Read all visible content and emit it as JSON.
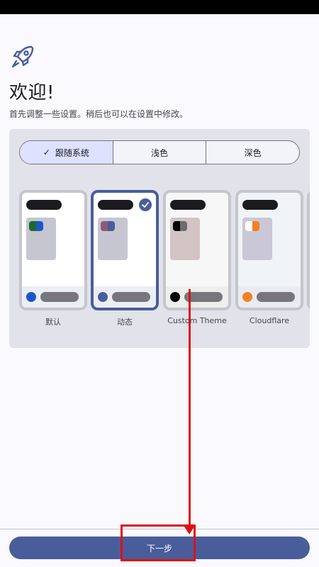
{
  "header": {
    "title": "欢迎!",
    "subtitle": "首先调整一些设置。稍后也可以在设置中修改。"
  },
  "mode_selector": {
    "options": [
      "跟随系统",
      "浅色",
      "深色"
    ],
    "selected_index": 0
  },
  "themes": [
    {
      "label": "默认",
      "selected": false,
      "card_bg": "#ffffff",
      "preview_color": "#c5c6d0",
      "chip_colors": [
        "#1a6b2c",
        "#1d56c9"
      ],
      "dot_color": "#1d56c9",
      "strip_color": "#eceef5"
    },
    {
      "label": "动态",
      "selected": true,
      "card_bg": "#ffffff",
      "preview_color": "#c5c6d0",
      "chip_colors": [
        "#8d5a7a",
        "#4a5d9b"
      ],
      "dot_color": "#4a5d9b",
      "strip_color": "#eceef5"
    },
    {
      "label": "Custom Theme",
      "selected": false,
      "card_bg": "#f7f7f7",
      "preview_color": "#d2c4c4",
      "chip_colors": [
        "#000000",
        "#6b6b6b"
      ],
      "dot_color": "#000000",
      "strip_color": "#eeeeee"
    },
    {
      "label": "Cloudflare",
      "selected": false,
      "card_bg": "#f0f3f7",
      "preview_color": "#cac7d6",
      "chip_colors": [
        "#ffffff",
        "#f38020"
      ],
      "dot_color": "#f38020",
      "strip_color": "#e8ecf2"
    }
  ],
  "footer": {
    "next_label": "下一步"
  },
  "colors": {
    "primary": "#4a5d9b",
    "annotation": "#dd1111"
  }
}
